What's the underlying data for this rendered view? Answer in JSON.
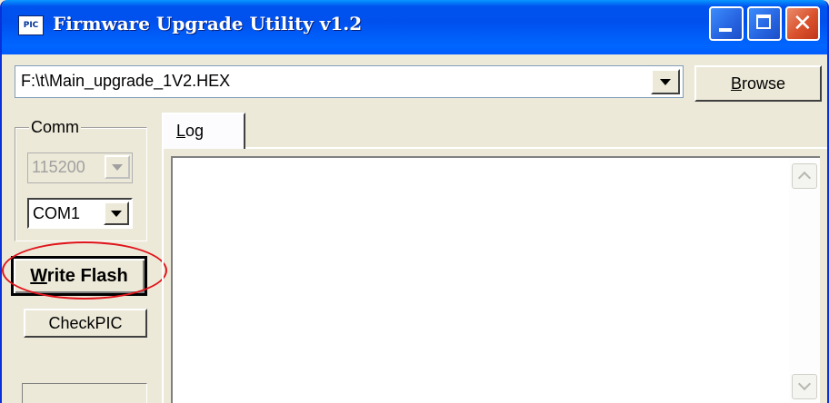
{
  "window": {
    "title": "Firmware Upgrade Utility v1.2",
    "icon_text": "PIC",
    "controls": [
      "minimize-icon",
      "maximize-icon",
      "close-icon"
    ]
  },
  "file": {
    "path": "F:\\t\\Main_upgrade_1V2.HEX",
    "browse_label": "Browse",
    "browse_accel": "B",
    "browse_rest": "rowse"
  },
  "comm": {
    "label": "Comm",
    "baud_rate": "115200",
    "port": "COM1"
  },
  "actions": {
    "write_flash_accel": "W",
    "write_flash_rest": "rite Flash",
    "write_flash_label": "Write Flash",
    "checkpic_label": "CheckPIC"
  },
  "log": {
    "tab_label": "Log",
    "tab_accel": "L",
    "tab_rest": "og",
    "content": ""
  },
  "colors": {
    "titlebar": "#0055ea",
    "highlight": "#e0141c",
    "window_bg": "#ece9d8"
  }
}
